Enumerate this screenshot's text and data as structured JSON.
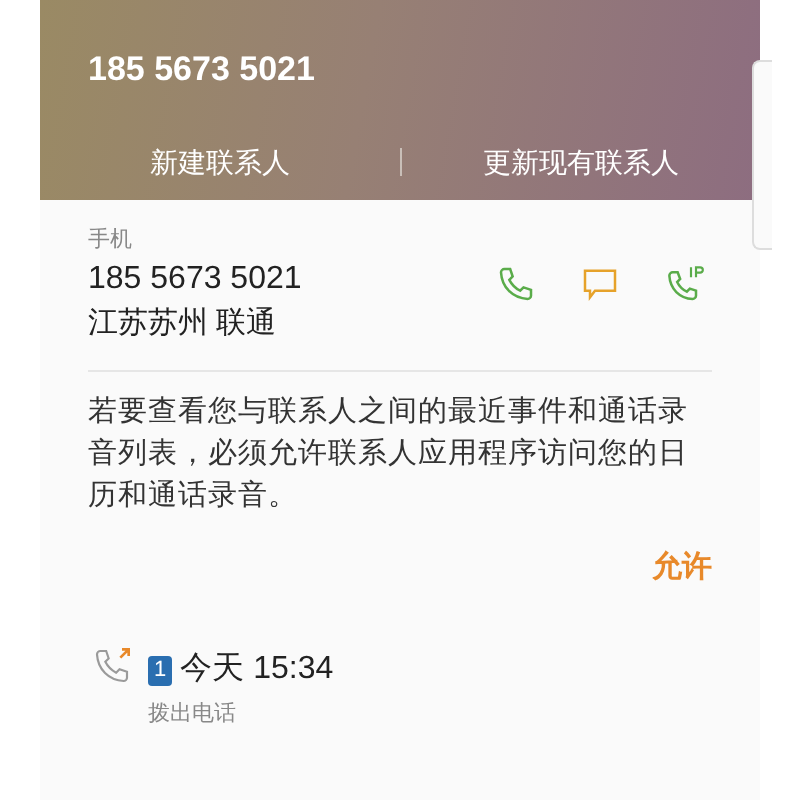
{
  "header": {
    "title": "185 5673 5021",
    "actions": [
      "新建联系人",
      "更新现有联系人"
    ]
  },
  "phone": {
    "type": "手机",
    "number": "185 5673 5021",
    "location": "江苏苏州 联通"
  },
  "permission": {
    "message": "若要查看您与联系人之间的最近事件和通话录音列表，必须允许联系人应用程序访问您的日历和通话录音。",
    "allow": "允许"
  },
  "calls": [
    {
      "kind": "outgoing",
      "sim": "1",
      "time": "今天 15:34",
      "label": "拨出电话"
    }
  ]
}
